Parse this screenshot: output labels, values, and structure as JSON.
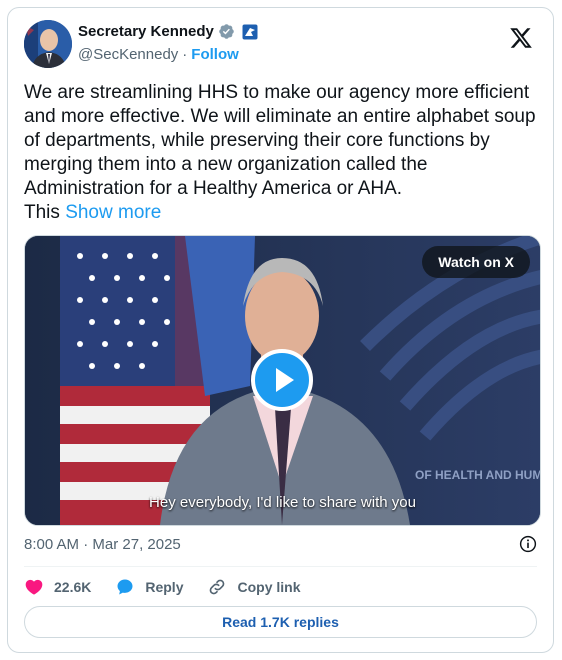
{
  "author": {
    "name": "Secretary Kennedy",
    "handle": "@SecKennedy",
    "separator": "·",
    "follow_label": "Follow",
    "verified_icon": "verified-badge-icon",
    "affiliate_icon": "gov-affiliate-icon",
    "avatar": "avatar"
  },
  "platform_icon": "x-logo-icon",
  "post": {
    "text": "We are streamlining HHS to make our agency more efficient and more effective. We will eliminate an entire alphabet soup of departments, while preserving their core functions by merging them into a new organization called the Administration for a Healthy America or AHA.",
    "text_tail": "This",
    "show_more_label": "Show more"
  },
  "video": {
    "watch_label": "Watch on X",
    "caption": "Hey everybody, I'd like to share with you",
    "backdrop_text": "OF HEALTH AND HUM",
    "play_icon": "play-icon"
  },
  "meta": {
    "time": "8:00 AM",
    "date": "Mar 27, 2025",
    "separator": "·",
    "info_icon": "info-icon"
  },
  "actions": {
    "like_count": "22.6K",
    "reply_label": "Reply",
    "copy_link_label": "Copy link"
  },
  "read_replies_label": "Read 1.7K replies",
  "colors": {
    "accent": "#1d9bf0",
    "like": "#f91880",
    "text": "#0f1419",
    "muted": "#536471",
    "border": "#cfd9de"
  }
}
